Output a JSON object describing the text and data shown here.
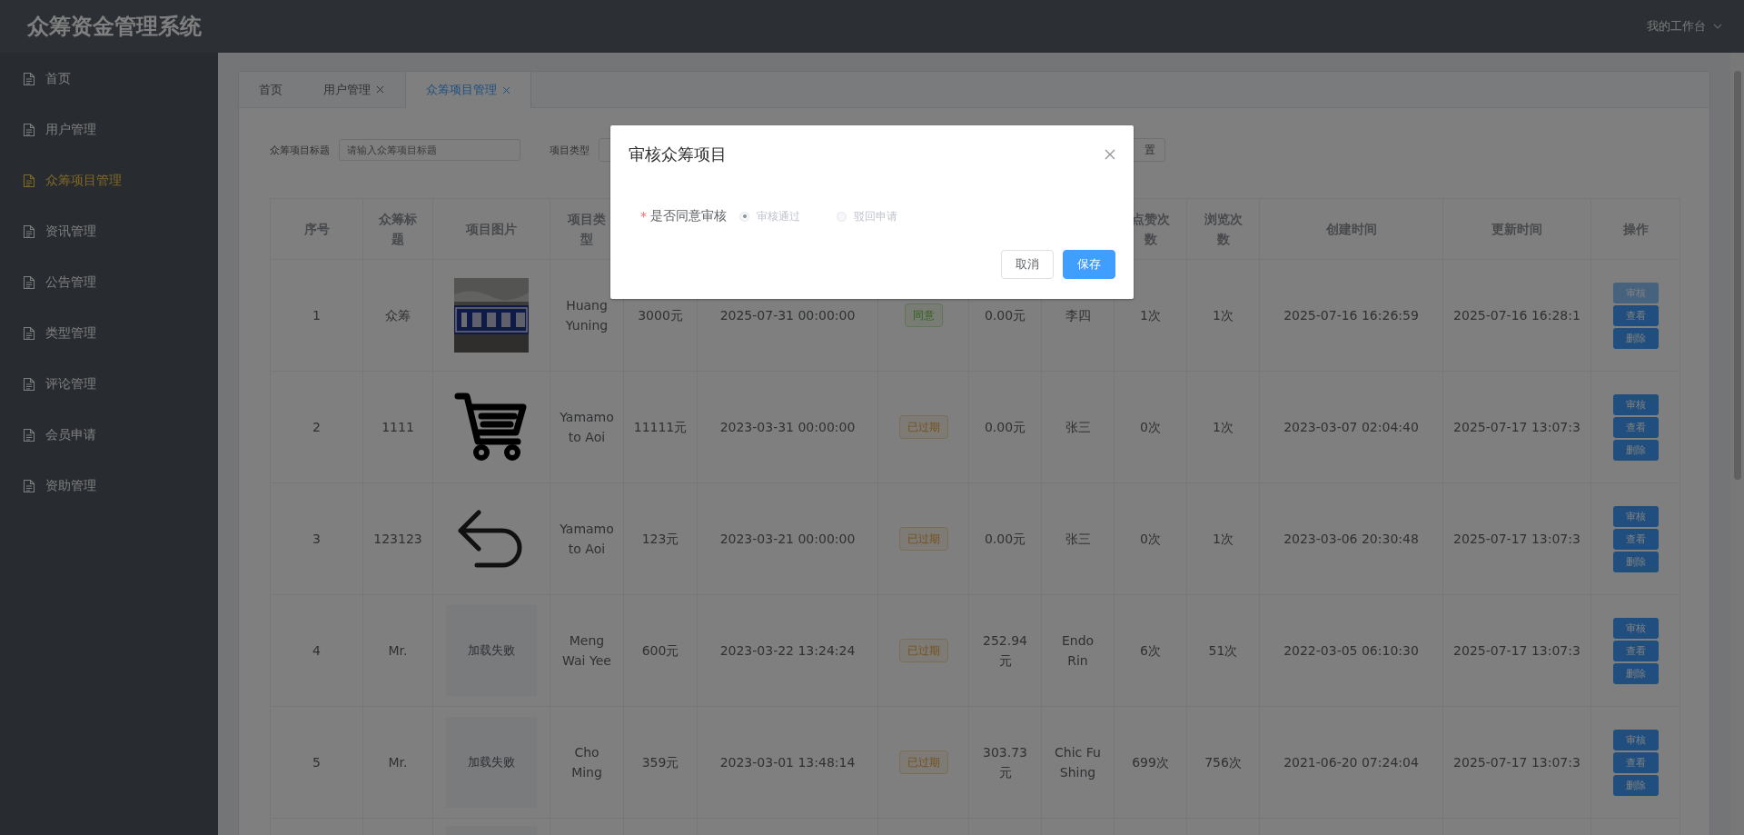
{
  "header": {
    "title": "众筹资金管理系统",
    "user_menu": "我的工作台"
  },
  "sidebar": {
    "items": [
      {
        "label": "首页",
        "selected": false
      },
      {
        "label": "用户管理",
        "selected": false
      },
      {
        "label": "众筹项目管理",
        "selected": true
      },
      {
        "label": "资讯管理",
        "selected": false
      },
      {
        "label": "公告管理",
        "selected": false
      },
      {
        "label": "类型管理",
        "selected": false
      },
      {
        "label": "评论管理",
        "selected": false
      },
      {
        "label": "会员申请",
        "selected": false
      },
      {
        "label": "资助管理",
        "selected": false
      }
    ]
  },
  "tabs": [
    {
      "label": "首页",
      "closable": false,
      "selected": false
    },
    {
      "label": "用户管理",
      "closable": true,
      "selected": false
    },
    {
      "label": "众筹项目管理",
      "closable": true,
      "selected": true
    }
  ],
  "search": {
    "title_label": "众筹项目标题",
    "title_placeholder": "请输入众筹项目标题",
    "type_label": "项目类型",
    "reset_button": "置"
  },
  "table": {
    "columns": [
      "序号",
      "众筹标题",
      "项目图片",
      "项目类型",
      "",
      "",
      "",
      "",
      "",
      "点赞次数",
      "浏览次数",
      "创建时间",
      "更新时间",
      "操作"
    ],
    "rows": [
      {
        "cells": [
          "1",
          "众筹",
          null,
          "Huang Yuning",
          "3000元",
          "2025-07-31 00:00:00",
          null,
          "0.00元",
          "李四",
          "1次",
          "1次",
          "2025-07-16 16:26:59",
          "2025-07-16 16:28:1"
        ],
        "image": {
          "kind": "picture"
        },
        "status": {
          "label": "同意",
          "kind": "success"
        },
        "actions": [
          {
            "label": "审核",
            "focused": true
          },
          {
            "label": "查看",
            "focused": false
          },
          {
            "label": "删除",
            "focused": false
          }
        ]
      },
      {
        "cells": [
          "2",
          "1111",
          null,
          "Yamamoto Aoi",
          "11111元",
          "2023-03-31 00:00:00",
          null,
          "0.00元",
          "张三",
          "0次",
          "1次",
          "2023-03-07 02:04:40",
          "2025-07-17 13:07:3"
        ],
        "image": {
          "kind": "cart"
        },
        "status": {
          "label": "已过期",
          "kind": "warning"
        },
        "actions": [
          {
            "label": "审核",
            "focused": false
          },
          {
            "label": "查看",
            "focused": false
          },
          {
            "label": "删除",
            "focused": false
          }
        ]
      },
      {
        "cells": [
          "3",
          "123123",
          null,
          "Yamamoto Aoi",
          "123元",
          "2023-03-21 00:00:00",
          null,
          "0.00元",
          "张三",
          "0次",
          "1次",
          "2023-03-06 20:30:48",
          "2025-07-17 13:07:3"
        ],
        "image": {
          "kind": "arrow"
        },
        "status": {
          "label": "已过期",
          "kind": "warning"
        },
        "actions": [
          {
            "label": "审核",
            "focused": false
          },
          {
            "label": "查看",
            "focused": false
          },
          {
            "label": "删除",
            "focused": false
          }
        ]
      },
      {
        "cells": [
          "4",
          "Mr.",
          null,
          "Meng Wai Yee",
          "600元",
          "2023-03-22 13:24:24",
          null,
          "252.94元",
          "Endo Rin",
          "6次",
          "51次",
          "2022-03-05 06:10:30",
          "2025-07-17 13:07:3"
        ],
        "image": {
          "kind": "failed",
          "text": "加载失败"
        },
        "status": {
          "label": "已过期",
          "kind": "warning"
        },
        "actions": [
          {
            "label": "审核",
            "focused": false
          },
          {
            "label": "查看",
            "focused": false
          },
          {
            "label": "删除",
            "focused": false
          }
        ]
      },
      {
        "cells": [
          "5",
          "Mr.",
          null,
          "Cho Ming",
          "359元",
          "2023-03-01 13:48:14",
          null,
          "303.73元",
          "Chic Fu Shing",
          "699次",
          "756次",
          "2021-06-20 07:24:04",
          "2025-07-17 13:07:3"
        ],
        "image": {
          "kind": "failed",
          "text": "加载失败"
        },
        "status": {
          "label": "已过期",
          "kind": "warning"
        },
        "actions": [
          {
            "label": "审核",
            "focused": false
          },
          {
            "label": "查看",
            "focused": false
          },
          {
            "label": "删除",
            "focused": false
          }
        ]
      }
    ]
  },
  "dialog": {
    "title": "审核众筹项目",
    "field_label": "是否同意审核",
    "required": true,
    "required_mark": "*",
    "options": [
      {
        "label": "审核通过",
        "selected": true,
        "disabled": true
      },
      {
        "label": "驳回申请",
        "selected": false,
        "disabled": true
      }
    ],
    "buttons": [
      {
        "label": "取消",
        "kind": "default"
      },
      {
        "label": "保存",
        "kind": "primary"
      }
    ]
  }
}
